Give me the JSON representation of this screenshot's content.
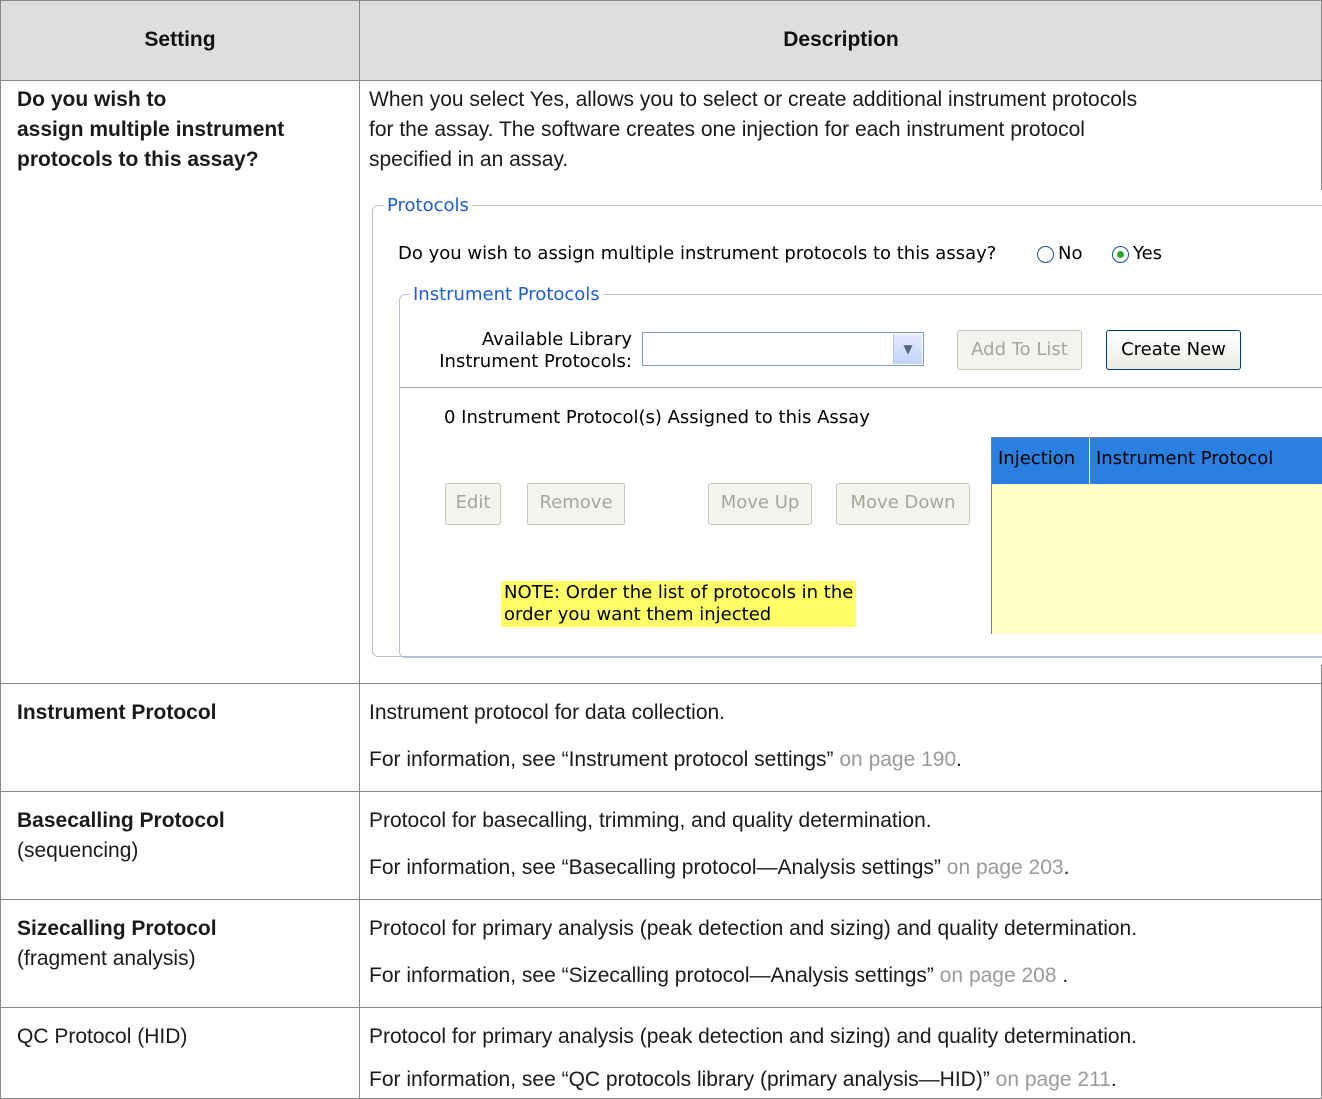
{
  "header": {
    "setting": "Setting",
    "description": "Description"
  },
  "rows": [
    {
      "setting_lines": [
        "Do you wish to",
        "assign multiple instrument",
        "protocols to this assay?"
      ],
      "desc_lines": [
        "When you select Yes, allows you to select or create additional instrument protocols",
        "for the assay. The software creates one injection for each instrument protocol",
        "specified in an assay."
      ]
    },
    {
      "setting": "Instrument Protocol",
      "desc": "Instrument protocol for data collection.",
      "info_prefix": "For information, see “Instrument protocol settings”",
      "info_link": "on page 190",
      "info_suffix": "."
    },
    {
      "setting": "Basecalling Protocol",
      "setting_sub": "(sequencing)",
      "desc": "Protocol for basecalling, trimming, and quality determination.",
      "info_prefix": "For information, see “Basecalling protocol—Analysis settings”",
      "info_link": "on page 203",
      "info_suffix": "."
    },
    {
      "setting": "Sizecalling Protocol",
      "setting_sub": "(fragment analysis)",
      "desc": "Protocol for primary analysis (peak detection and sizing) and quality determination.",
      "info_prefix": "For information, see “Sizecalling protocol—Analysis settings”",
      "info_link": "on page 208",
      "info_suffix": " ."
    },
    {
      "setting": "QC Protocol (HID)",
      "desc": "Protocol for primary analysis (peak detection and sizing) and quality determination.",
      "info_prefix": "For information, see “QC protocols library (primary analysis—HID)”",
      "info_link": "on page 211",
      "info_suffix": "."
    }
  ],
  "screenshot": {
    "protocols_legend": "Protocols",
    "question": "Do you wish to assign multiple instrument protocols to this assay?",
    "radio_no": "No",
    "radio_yes": "Yes",
    "selected": "Yes",
    "instrument_legend": "Instrument Protocols",
    "available_label_1": "Available Library",
    "available_label_2": "Instrument Protocols:",
    "combo_value": "",
    "add_to_list": "Add To List",
    "create_new": "Create New",
    "assigned_count": "0 Instrument Protocol(s) Assigned to this Assay",
    "edit": "Edit",
    "remove": "Remove",
    "move_up": "Move Up",
    "move_down": "Move Down",
    "note_line1": "NOTE: Order the list of protocols in the",
    "note_line2": "order you want them injected",
    "col_injection": "Injection",
    "col_instrument_protocol": "Instrument Protocol",
    "colors": {
      "table_header": "#2b7fe0",
      "table_body": "#ffffc8",
      "note_bg": "#ffff66",
      "legend_text": "#1e5bd7"
    }
  }
}
